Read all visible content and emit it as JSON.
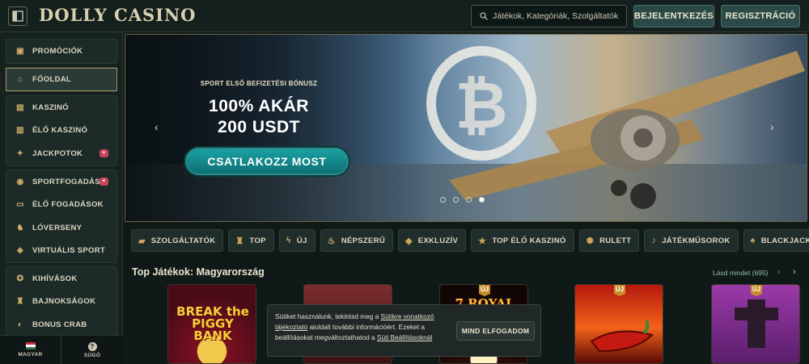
{
  "header": {
    "logo": "DOLLY CASINO",
    "search_placeholder": "Játékok, Kategóriák, Szolgáltatók",
    "login_label": "BEJELENTKEZÉS",
    "register_label": "REGISZTRÁCIÓ"
  },
  "sidebar": {
    "groups": [
      {
        "items": [
          {
            "label": "PROMÓCIÓK",
            "icon": "gift-icon"
          }
        ]
      },
      {
        "items": [
          {
            "label": "FŐOLDAL",
            "icon": "home-icon",
            "active": true
          }
        ]
      },
      {
        "items": [
          {
            "label": "KASZINÓ",
            "icon": "slot-machine-icon"
          },
          {
            "label": "ÉLŐ KASZINÓ",
            "icon": "cards-icon"
          },
          {
            "label": "JACKPOTOK",
            "icon": "coins-icon",
            "badge": "+"
          }
        ]
      },
      {
        "items": [
          {
            "label": "SPORTFOGADÁS",
            "icon": "ball-icon",
            "badge": "+"
          },
          {
            "label": "ÉLŐ FOGADÁSOK",
            "icon": "live-icon"
          },
          {
            "label": "LÓVERSENY",
            "icon": "horse-icon"
          },
          {
            "label": "VIRTUÁLIS SPORT",
            "icon": "virtual-icon"
          }
        ]
      },
      {
        "items": [
          {
            "label": "KIHÍVÁSOK",
            "icon": "challenge-icon"
          },
          {
            "label": "BAJNOKSÁGOK",
            "icon": "trophy-icon"
          },
          {
            "label": "BONUS CRAB",
            "icon": "crab-icon"
          }
        ]
      }
    ],
    "language_label": "MAGYAR",
    "help_label": "SÚGÓ"
  },
  "banner": {
    "kicker": "SPORT ELSŐ BEFIZETÉSI BÓNUSZ",
    "line1": "100% AKÁR",
    "line2": "200 USDT",
    "cta": "CSATLAKOZZ MOST",
    "slides": 4,
    "active_slide": 4
  },
  "categories": [
    {
      "label": "SZOLGÁLTATÓK",
      "icon": "provider-icon"
    },
    {
      "label": "TOP",
      "icon": "trophy-icon"
    },
    {
      "label": "ÚJ",
      "icon": "bolt-icon"
    },
    {
      "label": "NÉPSZERŰ",
      "icon": "flame-icon"
    },
    {
      "label": "EXKLUZÍV",
      "icon": "diamond-icon"
    },
    {
      "label": "TOP ÉLŐ KASZINÓ",
      "icon": "star-icon"
    },
    {
      "label": "RULETT",
      "icon": "roulette-icon"
    },
    {
      "label": "JÁTÉKMŰSOROK",
      "icon": "mic-icon"
    },
    {
      "label": "BLACKJACK",
      "icon": "cards-icon"
    }
  ],
  "top_games": {
    "title": "Top Játékok: Magyarország",
    "see_all": "Lásd mindet (695)",
    "games": [
      {
        "title": "BREAK the PIGGY BANK",
        "new": false
      },
      {
        "title": "",
        "new": false
      },
      {
        "title": "7 ROYAL",
        "new": true,
        "new_label": "ÚJ"
      },
      {
        "title": "",
        "new": true,
        "new_label": "ÚJ"
      },
      {
        "title": "",
        "new": true,
        "new_label": "ÚJ"
      }
    ]
  },
  "cookie": {
    "text_before": "Sütiket használunk, tekintsd meg a ",
    "link1": "Sütikre vonatkozó tájékoztató",
    "text_middle": " aloldalt további információért. Ezeket a beállításokat megváltoztathatod a ",
    "link2": "Süti Beállításoknál",
    "button": "MIND ELFOGADOM"
  }
}
